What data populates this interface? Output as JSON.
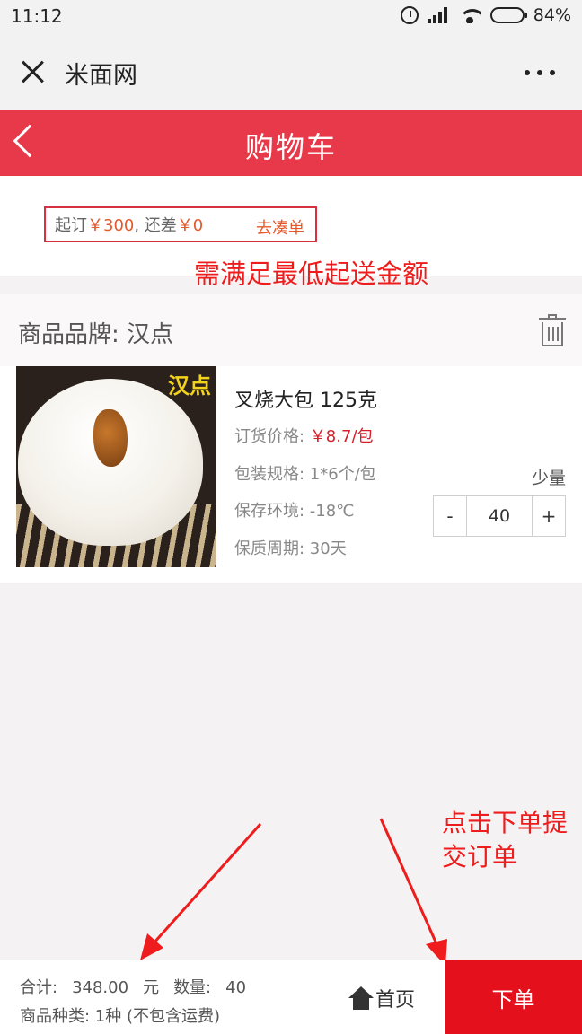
{
  "status_bar": {
    "time": "11:12",
    "battery": "84%",
    "battery_level": 0.84
  },
  "app_bar": {
    "title": "米面网"
  },
  "header": {
    "title": "购物车"
  },
  "min_order": {
    "prefix": "起订",
    "min_amount": "￥300",
    "middle": ", 还差",
    "remaining": "￥0",
    "link": "去凑单",
    "annotation": "需满足最低起送金额"
  },
  "cart": {
    "brand_label": "商品品牌: 汉点",
    "product": {
      "image_tag": "汉点",
      "name": "叉烧大包 125克",
      "price_label": "订货价格:",
      "price": "￥8.7/包",
      "spec": "包装规格: 1*6个/包",
      "storage": "保存环境: -18℃",
      "shelf_life": "保质周期: 30天",
      "small_qty": "少量",
      "minus": "-",
      "quantity": "40",
      "plus": "+"
    }
  },
  "annotation_submit": "点击下单提交订单",
  "bottom_bar": {
    "total_label": "合计:",
    "total_value": "348.00",
    "unit": "元",
    "count_label": "数量:",
    "count_value": "40",
    "kinds": "商品种类: 1种 (不包含运费)",
    "home": "首页",
    "order": "下单"
  },
  "colors": {
    "header": "#e8394a",
    "order_button": "#e4111d",
    "annotation": "#ee1c1c"
  }
}
